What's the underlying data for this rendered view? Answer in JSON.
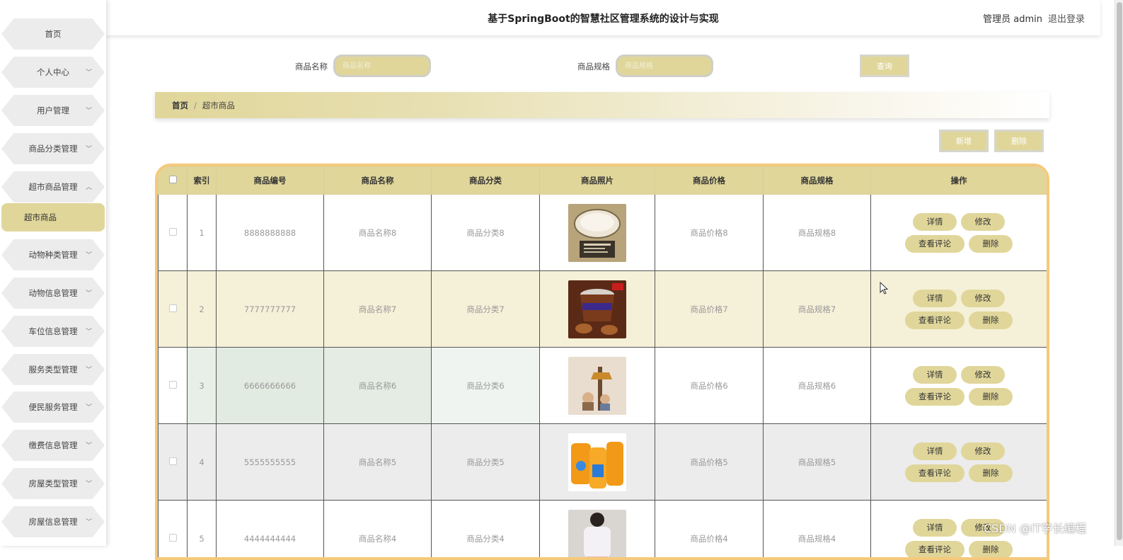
{
  "header": {
    "title": "基于SpringBoot的智慧社区管理系统的设计与实现",
    "user": "管理员 admin",
    "logout": "退出登录"
  },
  "sidebar": {
    "items": [
      {
        "label": "首页",
        "has_chevron": false
      },
      {
        "label": "个人中心",
        "has_chevron": true
      },
      {
        "label": "用户管理",
        "has_chevron": true
      },
      {
        "label": "商品分类管理",
        "has_chevron": true
      },
      {
        "label": "超市商品管理",
        "has_chevron": true,
        "expanded": true
      },
      {
        "label": "动物种类管理",
        "has_chevron": true
      },
      {
        "label": "动物信息管理",
        "has_chevron": true
      },
      {
        "label": "车位信息管理",
        "has_chevron": true
      },
      {
        "label": "服务类型管理",
        "has_chevron": true
      },
      {
        "label": "便民服务管理",
        "has_chevron": true
      },
      {
        "label": "缴费信息管理",
        "has_chevron": true
      },
      {
        "label": "房屋类型管理",
        "has_chevron": true
      },
      {
        "label": "房屋信息管理",
        "has_chevron": true
      }
    ],
    "active_sub": "超市商品",
    "chevron_down": "﹀",
    "chevron_up": "︿"
  },
  "search": {
    "name_label": "商品名称",
    "name_placeholder": "商品名称",
    "spec_label": "商品规格",
    "spec_placeholder": "商品规格",
    "query_label": "查询"
  },
  "breadcrumb": {
    "home": "首页",
    "separator": "/",
    "current": "超市商品"
  },
  "actions": {
    "add_label": "新增",
    "delete_label": "删除"
  },
  "table": {
    "headers": [
      "",
      "索引",
      "商品编号",
      "商品名称",
      "商品分类",
      "商品照片",
      "商品价格",
      "商品规格",
      "操作"
    ],
    "rows": [
      {
        "index": "1",
        "code": "8888888888",
        "name": "商品名称8",
        "category": "商品分类8",
        "price": "商品价格8",
        "spec": "商品规格8"
      },
      {
        "index": "2",
        "code": "7777777777",
        "name": "商品名称7",
        "category": "商品分类7",
        "price": "商品价格7",
        "spec": "商品规格7"
      },
      {
        "index": "3",
        "code": "6666666666",
        "name": "商品名称6",
        "category": "商品分类6",
        "price": "商品价格6",
        "spec": "商品规格6"
      },
      {
        "index": "4",
        "code": "5555555555",
        "name": "商品名称5",
        "category": "商品分类5",
        "price": "商品价格5",
        "spec": "商品规格5"
      },
      {
        "index": "5",
        "code": "4444444444",
        "name": "商品名称4",
        "category": "商品分类4",
        "price": "商品价格4",
        "spec": "商品规格4"
      }
    ],
    "row_actions": {
      "detail": "详情",
      "edit": "修改",
      "comments": "查看评论",
      "delete": "删除"
    }
  },
  "watermark": "CSDN @IT学长编程",
  "colors": {
    "accent": "#e0d69a",
    "table_border": "#f5c97c"
  }
}
